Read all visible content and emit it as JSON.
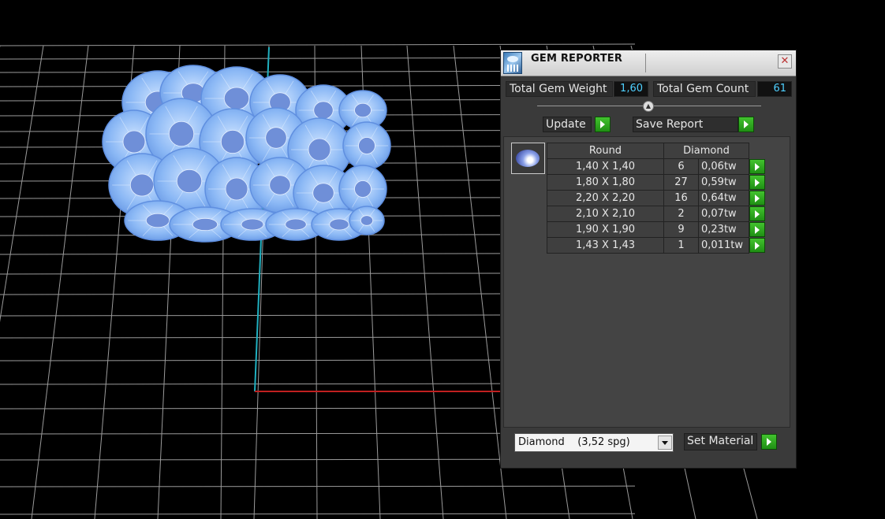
{
  "panel": {
    "title": "GEM REPORTER",
    "close_glyph": "✕",
    "total_weight_label": "Total Gem Weight",
    "total_weight_value": "1,60",
    "total_count_label": "Total Gem Count",
    "total_count_value": "61",
    "update_label": "Update",
    "save_report_label": "Save Report",
    "table": {
      "shape_header": "Round",
      "material_header": "Diamond",
      "rows": [
        {
          "size": "1,40 X 1,40",
          "count": "6",
          "weight": "0,06tw"
        },
        {
          "size": "1,80 X 1,80",
          "count": "27",
          "weight": "0,59tw"
        },
        {
          "size": "2,20 X 2,20",
          "count": "16",
          "weight": "0,64tw"
        },
        {
          "size": "2,10 X 2,10",
          "count": "2",
          "weight": "0,07tw"
        },
        {
          "size": "1,90 X 1,90",
          "count": "9",
          "weight": "0,23tw"
        },
        {
          "size": "1,43 X 1,43",
          "count": "1",
          "weight": "0,011tw"
        }
      ]
    },
    "material_select_value": "Diamond    (3,52 spg)",
    "set_material_label": "Set Material"
  },
  "colors": {
    "value_text": "#4fd0ff",
    "go_button": "#2fa820",
    "gem_wire": "#88bbff",
    "axis_y": "#20b0c0",
    "axis_x": "#c02020",
    "grid": "#cfcfcf"
  }
}
